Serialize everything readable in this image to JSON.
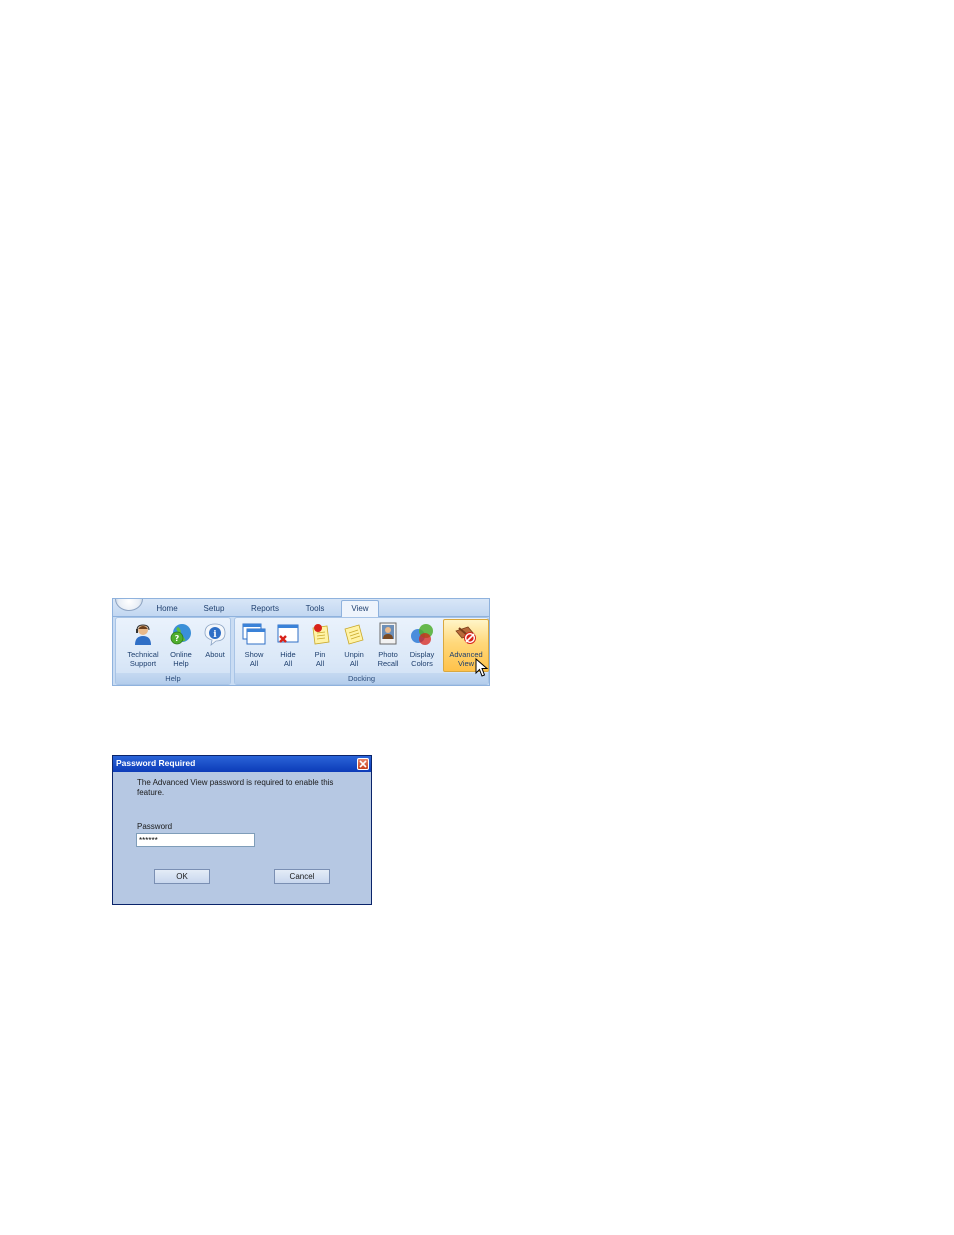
{
  "ribbon": {
    "tabs": [
      {
        "label": "Home",
        "active": false
      },
      {
        "label": "Setup",
        "active": false
      },
      {
        "label": "Reports",
        "active": false
      },
      {
        "label": "Tools",
        "active": false
      },
      {
        "label": "View",
        "active": true
      }
    ],
    "groups": {
      "help": {
        "label": "Help",
        "buttons": [
          {
            "label": "Technical\nSupport",
            "icon": "support-person-icon"
          },
          {
            "label": "Online\nHelp",
            "icon": "help-globe-icon"
          },
          {
            "label": "About",
            "icon": "info-icon"
          }
        ]
      },
      "docking": {
        "label": "Docking",
        "buttons": [
          {
            "label": "Show\nAll",
            "icon": "show-all-windows-icon"
          },
          {
            "label": "Hide\nAll",
            "icon": "hide-all-windows-icon"
          },
          {
            "label": "Pin\nAll",
            "icon": "pin-icon"
          },
          {
            "label": "Unpin\nAll",
            "icon": "unpin-icon"
          },
          {
            "label": "Photo\nRecall",
            "icon": "photo-icon"
          },
          {
            "label": "Display\nColors",
            "icon": "color-circles-icon"
          },
          {
            "label": "Advanced\nView",
            "icon": "advanced-view-icon",
            "hovered": true
          }
        ]
      }
    }
  },
  "dialog": {
    "title": "Password Required",
    "message": "The Advanced View password is required to enable this feature.",
    "password_label": "Password",
    "password_value": "******",
    "ok_label": "OK",
    "cancel_label": "Cancel"
  },
  "colors": {
    "ribbon_bg": "#c9dcf3",
    "hover_accent": "#ffc24a",
    "titlebar": "#0c3bb8",
    "dialog_bg": "#b6c8e3"
  }
}
